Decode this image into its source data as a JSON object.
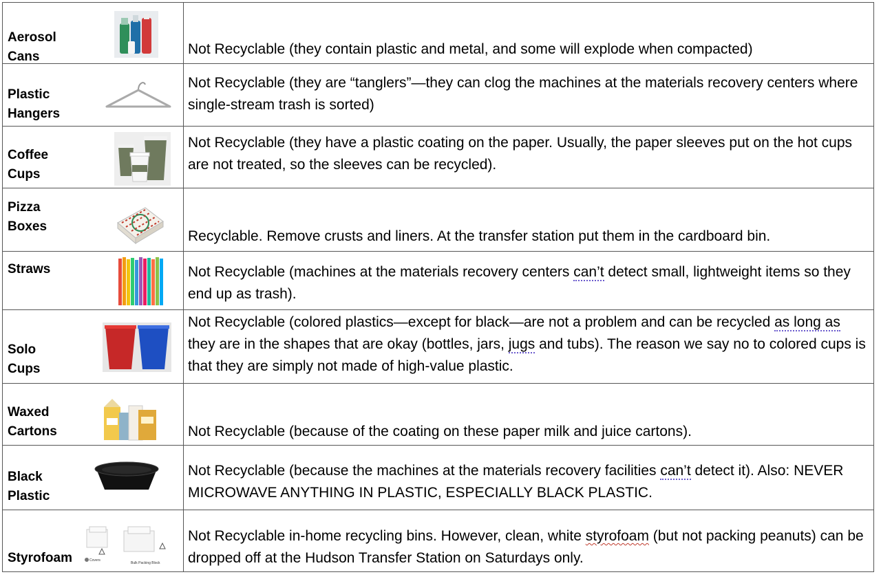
{
  "rows": [
    {
      "item": [
        "Aerosol",
        "Cans"
      ],
      "text": "Not Recyclable (they contain plastic and metal, and some will explode when compacted)"
    },
    {
      "item": [
        "Plastic",
        "Hangers"
      ],
      "text": "Not Recyclable (they are “tanglers”—they can clog the machines at the materials recovery centers where single-stream trash is sorted)"
    },
    {
      "item": [
        "Coffee",
        "Cups"
      ],
      "text": "Not Recyclable (they have a plastic coating on the paper. Usually, the paper sleeves put on the hot cups are not treated, so the sleeves can be recycled)."
    },
    {
      "item": [
        "Pizza",
        "Boxes"
      ],
      "text": "Recyclable. Remove crusts and liners. At the transfer station put them in the cardboard bin."
    },
    {
      "item": [
        "Straws"
      ],
      "text_parts": [
        "Not Recyclable (machines at the materials recovery centers ",
        "can’t",
        " detect small, lightweight items so they end up as trash)."
      ]
    },
    {
      "item": [
        "Solo",
        "Cups"
      ],
      "text_parts": [
        "Not Recyclable (colored plastics—except for black—are not a problem and can be recycled ",
        "as long as",
        " they are in the shapes that are okay (bottles, jars, ",
        "jugs",
        " and tubs). The reason we say no to colored cups is that they are simply not made of high-value plastic."
      ]
    },
    {
      "item": [
        "Waxed",
        "Cartons"
      ],
      "text": "Not Recyclable (because of the coating on these paper milk and juice cartons)."
    },
    {
      "item": [
        "Black",
        "Plastic"
      ],
      "text_parts": [
        "Not Recyclable (because the machines at the materials recovery facilities ",
        "can’t",
        " detect it). Also: NEVER MICROWAVE ANYTHING IN PLASTIC, ESPECIALLY BLACK PLASTIC."
      ]
    },
    {
      "item": [
        "Styrofoam"
      ],
      "text_parts": [
        "Not Recyclable in-home recycling bins. However, clean, white ",
        "styrofoam",
        " (but not packing peanuts) can be dropped off at the Hudson Transfer Station on Saturdays only."
      ],
      "img_captions": [
        "Covers",
        "Bulk Packing Block"
      ]
    }
  ]
}
